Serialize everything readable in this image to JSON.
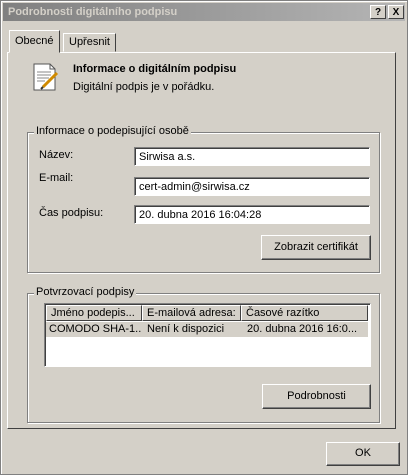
{
  "window": {
    "title": "Podrobnosti digitálního podpisu"
  },
  "titlebar_buttons": {
    "help": "?",
    "close": "X"
  },
  "tabs": [
    {
      "label": "Obecné"
    },
    {
      "label": "Upřesnit"
    }
  ],
  "header": {
    "title": "Informace o digitálním podpisu",
    "status": "Digitální podpis je v pořádku."
  },
  "signer": {
    "legend": "Informace o podepisující osobě",
    "name_label": "Název:",
    "name_value": "Sirwisa a.s.",
    "email_label": "E-mail:",
    "email_value": "cert-admin@sirwisa.cz",
    "time_label": "Čas podpisu:",
    "time_value": "20.  dubna  2016 16:04:28",
    "view_cert_button": "Zobrazit certifikát"
  },
  "countersignatures": {
    "legend": "Potvrzovací podpisy",
    "columns": [
      "Jméno podepis...",
      "E-mailová adresa:",
      "Časové razítko"
    ],
    "rows": [
      [
        "COMODO SHA-1...",
        "Není k dispozici",
        "20. dubna 2016 16:0..."
      ]
    ],
    "details_button": "Podrobnosti"
  },
  "footer": {
    "ok_button": "OK"
  }
}
